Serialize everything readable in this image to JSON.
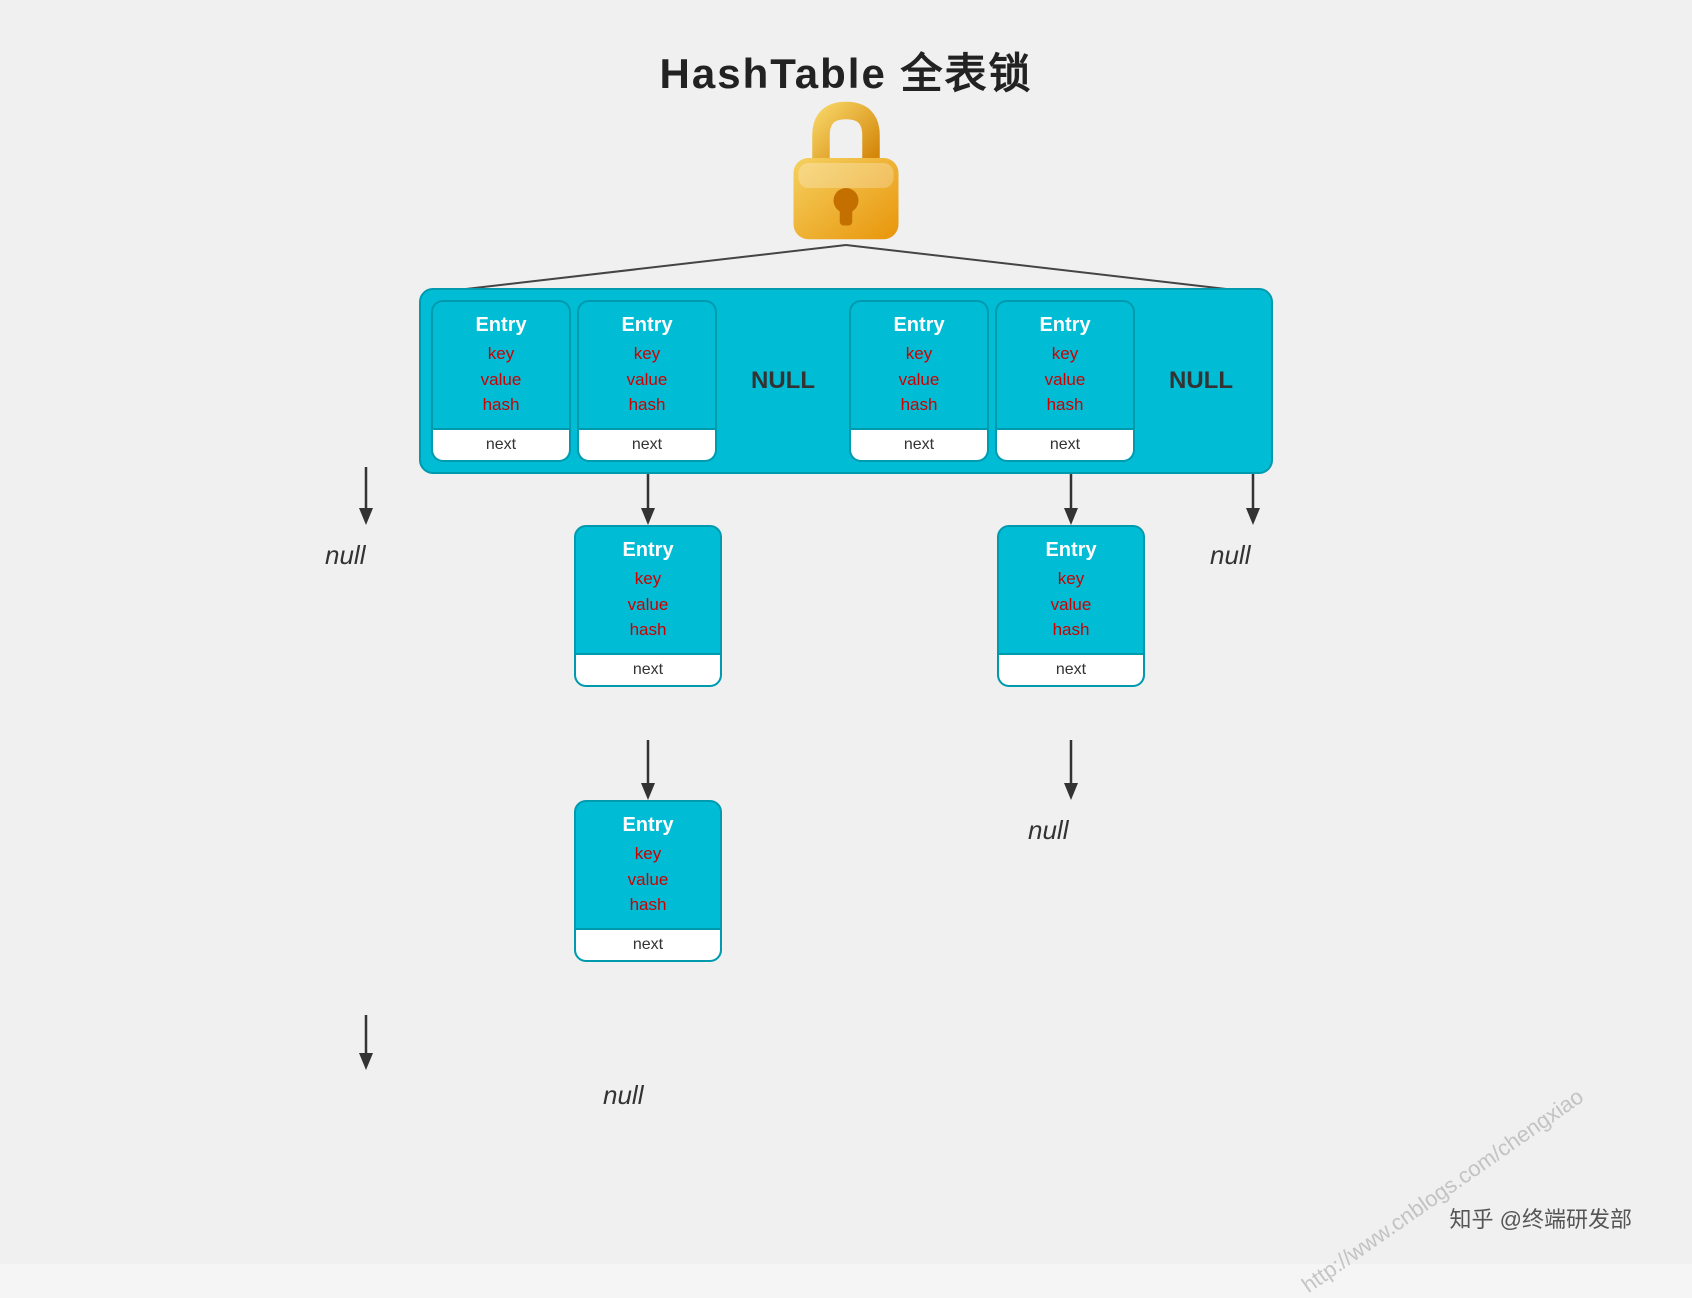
{
  "title": "HashTable 全表锁",
  "entry_label": "Entry",
  "fields": [
    "key",
    "value",
    "hash"
  ],
  "next_label": "next",
  "null_label": "NULL",
  "null_lower": "null",
  "watermark": "http://www.cnblogs.com/chengxiao",
  "attribution": "知乎 @终端研发部",
  "lock_color_top": "#f5c842",
  "lock_color_bottom": "#e89a00",
  "teal": "#00bcd4",
  "top_row": [
    {
      "type": "entry",
      "has_next": true
    },
    {
      "type": "entry",
      "has_next": true
    },
    {
      "type": "null"
    },
    {
      "type": "entry",
      "has_next": true
    },
    {
      "type": "entry",
      "has_next": true
    },
    {
      "type": "null"
    }
  ]
}
